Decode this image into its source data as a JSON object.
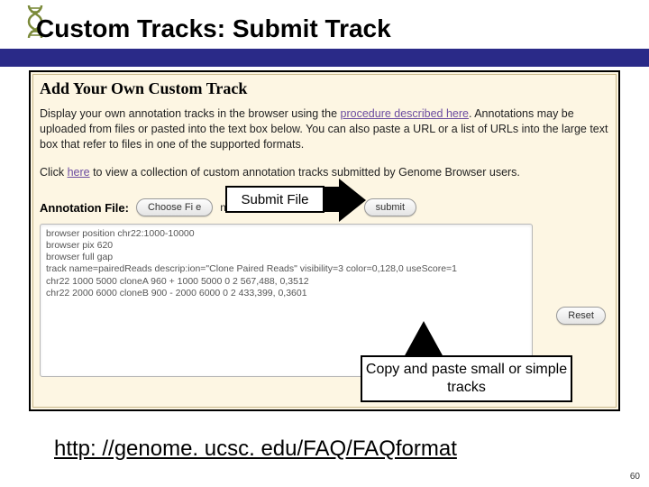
{
  "slide": {
    "title": "Custom Tracks: Submit Track",
    "page_number": "60",
    "footer_url": "http: //genome. ucsc. edu/FAQ/FAQformat"
  },
  "panel": {
    "heading": "Add Your Own Custom Track",
    "description_pre": "Display your own annotation tracks in the browser using the ",
    "description_link": "procedure described here",
    "description_post": ". Annotations may be uploaded from files or pasted into the text box below. You can also paste a URL or a list of URLs into the large text box that refer to files in one of the supported formats.",
    "click_pre": "Click ",
    "click_link": "here",
    "click_post": " to view a collection of custom annotation tracks submitted by Genome Browser users."
  },
  "form": {
    "annotation_label": "Annotation File:",
    "choose_file": "Choose Fi e",
    "no_file": "no",
    "submit_label": "submit",
    "reset_label": "Reset",
    "textarea_value": "browser position chr22:1000-10000\nbrowser pix 620\nbrowser full gap\ntrack name=pairedReads descrip:ion=\"Clone Paired Reads\" visibility=3 color=0,128,0 useScore=1\nchr22 1000 5000 cloneA 960 + 1000 5000 0 2 567,488, 0,3512\nchr22 2000 6000 cloneB 900 - 2000 6000 0 2 433,399, 0,3601"
  },
  "callouts": {
    "submit_file": "Submit File",
    "copy_paste": "Copy and paste small or simple tracks"
  },
  "icons": {
    "dna": "dna-helix"
  }
}
